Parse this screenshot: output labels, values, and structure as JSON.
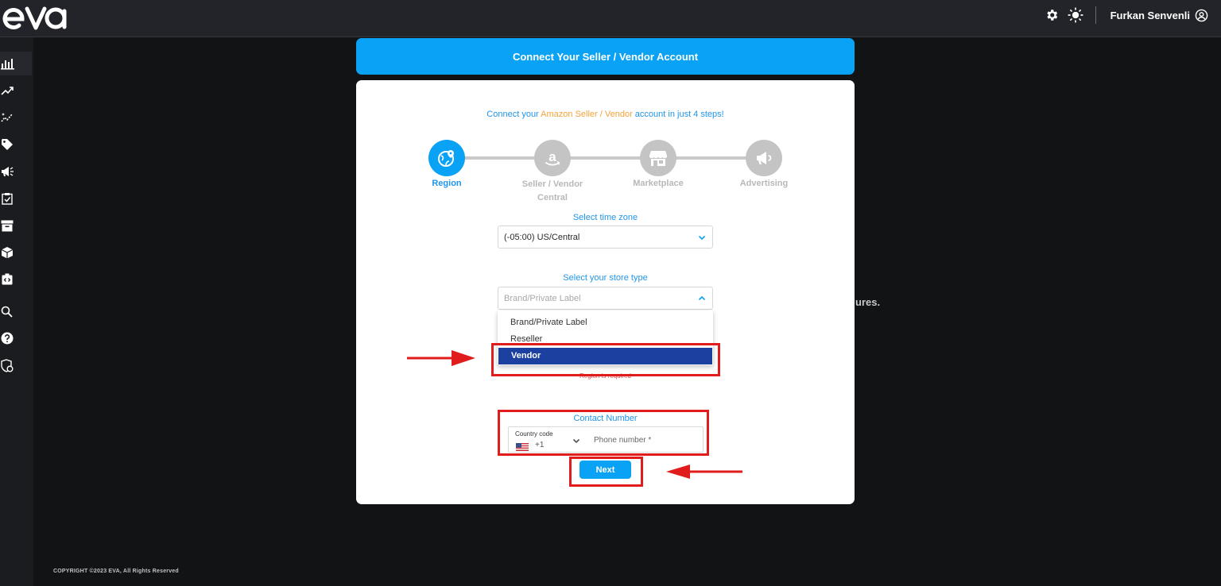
{
  "app": {
    "logo_text": "eva"
  },
  "topbar": {
    "user_name": "Furkan Senvenli"
  },
  "sidebar": {
    "items": [
      "dashboard-icon",
      "trend-icon",
      "sparkle-chart-icon",
      "tag-icon",
      "megaphone-icon",
      "clipboard-check-icon",
      "archive-icon",
      "package-icon",
      "report-icon",
      "search-icon",
      "help-icon",
      "security-icon"
    ],
    "active_index": 0
  },
  "background": {
    "truncated_text": "ures."
  },
  "footer": {
    "copyright": "COPYRIGHT ©2023 EVA, All Rights Reserved"
  },
  "modal": {
    "header_title": "Connect Your Seller / Vendor Account",
    "intro": {
      "before": "Connect your ",
      "highlight": "Amazon Seller / Vendor",
      "after": " account in just 4 steps!"
    },
    "steps": [
      {
        "label": "Region",
        "icon": "globe-pin-icon",
        "active": true
      },
      {
        "label": "Seller / Vendor Central",
        "icon": "amazon-icon",
        "active": false
      },
      {
        "label": "Marketplace",
        "icon": "store-icon",
        "active": false
      },
      {
        "label": "Advertising",
        "icon": "megaphone-icon",
        "active": false
      }
    ],
    "timezone": {
      "title": "Select time zone",
      "value": "(-05:00) US/Central"
    },
    "store_type": {
      "title": "Select your store type",
      "placeholder": "Brand/Private Label",
      "options": [
        "Brand/Private Label",
        "Reseller",
        "Vendor"
      ],
      "highlighted": "Vendor"
    },
    "error": "Region is required",
    "contact": {
      "title": "Contact Number",
      "country_code_label": "Country code",
      "country_code_value": "+1",
      "phone_placeholder": "Phone number *"
    },
    "next_label": "Next"
  },
  "colors": {
    "accent": "#0aa2f5",
    "highlight_orange": "#f5a33b",
    "selected_option": "#1c40a0",
    "annotation_red": "#e11c1c"
  }
}
